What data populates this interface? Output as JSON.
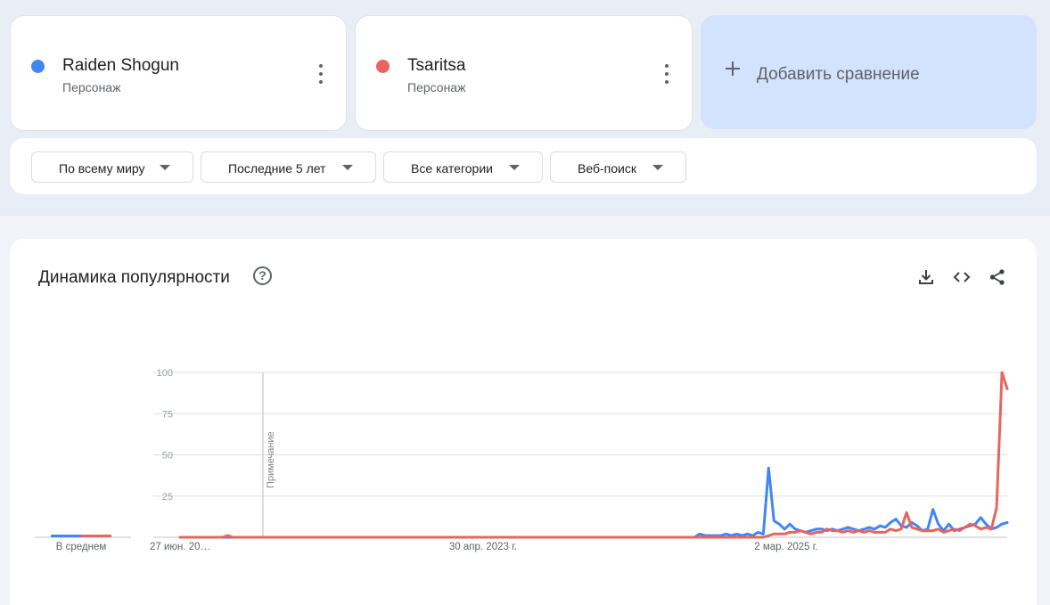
{
  "terms": [
    {
      "name": "Raiden Shogun",
      "type": "Персонаж",
      "color": "#4285f4"
    },
    {
      "name": "Tsaritsa",
      "type": "Персонаж",
      "color": "#e8655e"
    }
  ],
  "add_comparison": {
    "label": "Добавить сравнение"
  },
  "filters": [
    {
      "label": "По всему миру"
    },
    {
      "label": "Последние 5 лет"
    },
    {
      "label": "Все категории"
    },
    {
      "label": "Веб-поиск"
    }
  ],
  "chart": {
    "title": "Динамика популярности",
    "help_icon": "help-icon",
    "tools": [
      "download-icon",
      "embed-code-icon",
      "share-icon"
    ]
  },
  "chart_data": {
    "type": "line",
    "ylim": [
      0,
      100
    ],
    "yticks": [
      25,
      50,
      75,
      100
    ],
    "xtick_labels": [
      "27 июн. 20…",
      "30 апр. 2023 г.",
      "2 мар. 2025 г."
    ],
    "xtick_index": [
      0,
      96,
      192
    ],
    "x_start_label": "27 июн. 20…",
    "x_end_index": 260,
    "note_label": "Примечание",
    "note_index": 26,
    "average_label": "В среднем",
    "grid": true,
    "series": [
      {
        "name": "Raiden Shogun",
        "color": "#4285f4",
        "average": 1,
        "points": [
          [
            0,
            0
          ],
          [
            190,
            0
          ],
          [
            194,
            0
          ],
          [
            196,
            2
          ],
          [
            198,
            1
          ],
          [
            200,
            1
          ],
          [
            202,
            1
          ],
          [
            204,
            1
          ],
          [
            206,
            2
          ],
          [
            208,
            1
          ],
          [
            210,
            2
          ],
          [
            212,
            1
          ],
          [
            214,
            2
          ],
          [
            216,
            1
          ],
          [
            218,
            3
          ],
          [
            220,
            2
          ],
          [
            222,
            42
          ],
          [
            224,
            10
          ],
          [
            226,
            8
          ],
          [
            228,
            5
          ],
          [
            230,
            8
          ],
          [
            232,
            5
          ],
          [
            234,
            4
          ],
          [
            236,
            3
          ],
          [
            238,
            4
          ],
          [
            240,
            5
          ],
          [
            242,
            5
          ],
          [
            244,
            4
          ],
          [
            246,
            5
          ],
          [
            248,
            4
          ],
          [
            250,
            5
          ],
          [
            252,
            6
          ],
          [
            254,
            5
          ],
          [
            256,
            4
          ],
          [
            258,
            5
          ],
          [
            260,
            6
          ],
          [
            262,
            5
          ],
          [
            264,
            7
          ],
          [
            266,
            6
          ],
          [
            268,
            9
          ],
          [
            270,
            11
          ],
          [
            272,
            7
          ],
          [
            274,
            6
          ],
          [
            276,
            9
          ],
          [
            278,
            7
          ],
          [
            280,
            4
          ],
          [
            282,
            5
          ],
          [
            284,
            17
          ],
          [
            286,
            8
          ],
          [
            288,
            4
          ],
          [
            290,
            8
          ],
          [
            292,
            4
          ],
          [
            294,
            5
          ],
          [
            296,
            6
          ],
          [
            298,
            7
          ],
          [
            300,
            8
          ],
          [
            302,
            12
          ],
          [
            304,
            8
          ],
          [
            306,
            5
          ],
          [
            308,
            6
          ],
          [
            310,
            8
          ],
          [
            312,
            9
          ]
        ]
      },
      {
        "name": "Tsaritsa",
        "color": "#e8655e",
        "average": 1,
        "points": [
          [
            0,
            0
          ],
          [
            16,
            0
          ],
          [
            18,
            1
          ],
          [
            20,
            0
          ],
          [
            190,
            0
          ],
          [
            220,
            0
          ],
          [
            224,
            2
          ],
          [
            226,
            2
          ],
          [
            228,
            2
          ],
          [
            230,
            3
          ],
          [
            232,
            3
          ],
          [
            234,
            4
          ],
          [
            236,
            3
          ],
          [
            238,
            2
          ],
          [
            240,
            3
          ],
          [
            242,
            3
          ],
          [
            244,
            5
          ],
          [
            246,
            4
          ],
          [
            248,
            4
          ],
          [
            250,
            3
          ],
          [
            252,
            4
          ],
          [
            254,
            3
          ],
          [
            256,
            4
          ],
          [
            258,
            3
          ],
          [
            260,
            4
          ],
          [
            262,
            3
          ],
          [
            264,
            3
          ],
          [
            266,
            3
          ],
          [
            268,
            5
          ],
          [
            270,
            4
          ],
          [
            272,
            5
          ],
          [
            274,
            15
          ],
          [
            276,
            6
          ],
          [
            278,
            5
          ],
          [
            280,
            4
          ],
          [
            282,
            4
          ],
          [
            284,
            4
          ],
          [
            286,
            5
          ],
          [
            288,
            3
          ],
          [
            290,
            4
          ],
          [
            292,
            5
          ],
          [
            294,
            4
          ],
          [
            296,
            6
          ],
          [
            298,
            8
          ],
          [
            300,
            7
          ],
          [
            302,
            5
          ],
          [
            304,
            6
          ],
          [
            306,
            5
          ],
          [
            308,
            18
          ],
          [
            310,
            100
          ],
          [
            312,
            90
          ]
        ]
      }
    ]
  }
}
